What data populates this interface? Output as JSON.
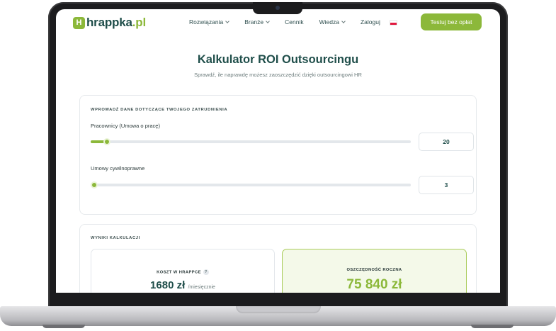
{
  "brand": {
    "logo_icon": "H",
    "name_prefix": "hrappka",
    "name_suffix": ".pl"
  },
  "nav": {
    "items": [
      {
        "label": "Rozwiązania",
        "dropdown": true
      },
      {
        "label": "Branże",
        "dropdown": true
      },
      {
        "label": "Cennik",
        "dropdown": false
      },
      {
        "label": "Wiedza",
        "dropdown": true
      },
      {
        "label": "Zaloguj",
        "dropdown": false
      }
    ],
    "language_flag": "pl-flag-icon",
    "cta_label": "Testuj bez opłat"
  },
  "page": {
    "title": "Kalkulator ROI Outsourcingu",
    "subtitle": "Sprawdź, ile naprawdę możesz zaoszczędzić dzięki outsourcingowi HR"
  },
  "inputs_card": {
    "section_label": "WPROWADŹ DANE DOTYCZĄCE TWOJEGO ZATRUDNIENIA",
    "fields": [
      {
        "label": "Pracownicy (Umowa o pracę)",
        "value": "20",
        "slider_fraction": 0.05
      },
      {
        "label": "Umowy cywilnoprawne",
        "value": "3",
        "slider_fraction": 0.01
      }
    ]
  },
  "results_card": {
    "section_label": "WYNIKI KALKULACJI",
    "cost": {
      "label": "KOSZT W HRAPPCE",
      "help": "?",
      "value": "1680 zł",
      "unit": "/miesięcznie"
    },
    "savings": {
      "label": "OSZCZĘDNOŚĆ ROCZNA",
      "value": "75 840 zł"
    }
  },
  "colors": {
    "accent": "#8cb83a",
    "brand_dark": "#1f4e4a"
  }
}
